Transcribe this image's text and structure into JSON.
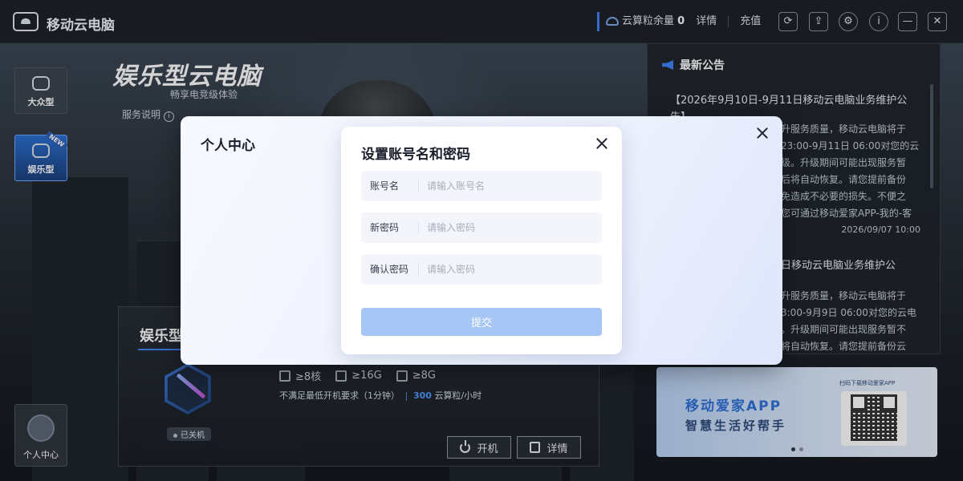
{
  "app": {
    "title": "移动云电脑"
  },
  "titlebar": {
    "balance_label": "云算粒余量",
    "balance_value": "0",
    "details_link": "详情",
    "recharge_link": "充值"
  },
  "sidebar": {
    "items": [
      {
        "label": "大众型",
        "active": false
      },
      {
        "label": "娱乐型",
        "active": true,
        "badge": "NEW"
      }
    ],
    "user_center": "个人中心"
  },
  "hero": {
    "brand_title": "娱乐型云电脑",
    "brand_subtitle": "畅享电竞级体验",
    "service_note": "服务说明"
  },
  "game_card": {
    "name": "娱乐型",
    "status": "已关机",
    "specs": [
      {
        "icon": "cpu-icon",
        "value": "≥8核"
      },
      {
        "icon": "storage-icon",
        "value": "≥16G"
      },
      {
        "icon": "memory-icon",
        "value": "≥8G"
      }
    ],
    "requirement": "不满足最低开机要求（1分钟）",
    "cost_value": "300",
    "cost_unit": "云算粒/小时",
    "power_label": "开机",
    "details_label": "详情"
  },
  "notices": {
    "heading": "最新公告",
    "items": [
      {
        "title_line1": "【2026年9月10日-9月11日移动云电脑业务维护公",
        "title_line2": "告】",
        "body": [
          "升服务质量，移动云电脑将于",
          "23:00-9月11日 06:00对您的云",
          "级。升级期间可能出现服务暂",
          "后将自动恢复。请您提前备份",
          "免造成不必要的损失。不便之",
          "您可通过移动爱家APP-我的-客"
        ],
        "date": "2026/09/07 10:00"
      },
      {
        "title_line1": "日移动云电脑业务维护公",
        "body": [
          "升服务质量，移动云电脑将于",
          "3:00-9月9日 06:00对您的云电",
          "。升级期间可能出现服务暂不",
          "将自动恢复。请您提前备份云"
        ]
      }
    ]
  },
  "banner": {
    "title": "移动爱家APP",
    "subtitle": "智慧生活好帮手",
    "qr_caption": "扫码下载移动爱家APP"
  },
  "personal_center": {
    "title": "个人中心"
  },
  "account_dialog": {
    "title": "设置账号名和密码",
    "fields": [
      {
        "label": "账号名",
        "placeholder": "请输入账号名",
        "value": ""
      },
      {
        "label": "新密码",
        "placeholder": "请输入密码",
        "value": ""
      },
      {
        "label": "确认密码",
        "placeholder": "请输入密码",
        "value": ""
      }
    ],
    "submit_label": "提交"
  },
  "colors": {
    "accent": "#3c82f6",
    "submit_disabled": "#a6c6f5",
    "cost_highlight": "#4f9bff"
  }
}
